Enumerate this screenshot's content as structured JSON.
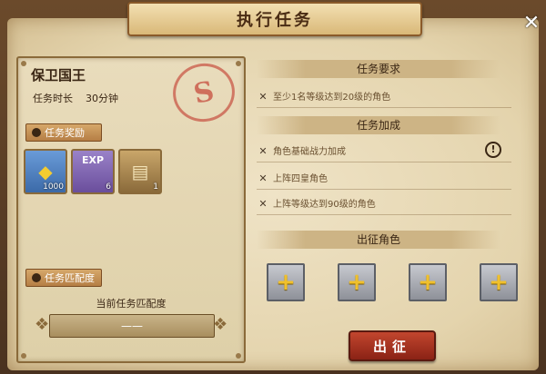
{
  "header": {
    "title": "执行任务"
  },
  "mission": {
    "name": "保卫国王",
    "duration_label": "任务时长",
    "duration_value": "30分钟",
    "stamp_letter": "S"
  },
  "rewards": {
    "tag": "任务奖励",
    "items": [
      {
        "icon": "gold-ore-icon",
        "count": "1000"
      },
      {
        "icon": "exp-potion-icon",
        "label": "EXP",
        "count": "6"
      },
      {
        "icon": "scroll-icon",
        "count": "1"
      }
    ]
  },
  "match": {
    "tag": "任务匹配度",
    "label": "当前任务匹配度",
    "value": "——"
  },
  "requirements": {
    "header": "任务要求",
    "items": [
      "至少1名等级达到20级的角色"
    ]
  },
  "bonuses": {
    "header": "任务加成",
    "items": [
      "角色基础战力加成",
      "上阵四皇角色",
      "上阵等级达到90级的角色"
    ]
  },
  "deploy": {
    "header": "出征角色",
    "slots": [
      "+",
      "+",
      "+",
      "+"
    ],
    "go_label": "出征"
  },
  "colors": {
    "accent": "#b57e45",
    "go_button": "#a8321f",
    "slot_plus": "#f0c02c"
  }
}
